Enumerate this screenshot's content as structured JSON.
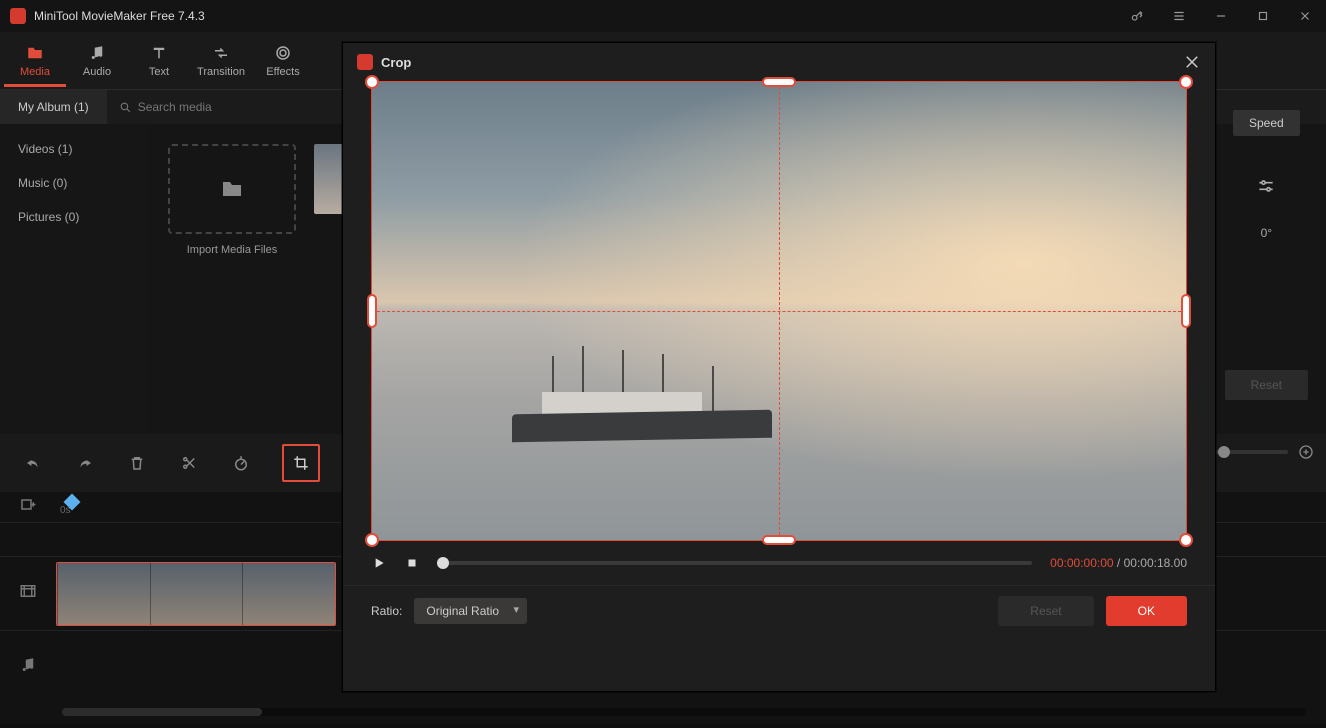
{
  "app_title": "MiniTool MovieMaker Free 7.4.3",
  "toolbar": [
    {
      "label": "Media",
      "active": true
    },
    {
      "label": "Audio",
      "active": false
    },
    {
      "label": "Text",
      "active": false
    },
    {
      "label": "Transition",
      "active": false
    },
    {
      "label": "Effects",
      "active": false
    }
  ],
  "subbar": {
    "album": "My Album (1)",
    "search_placeholder": "Search media"
  },
  "sidebar": [
    {
      "label": "Videos (1)"
    },
    {
      "label": "Music (0)"
    },
    {
      "label": "Pictures (0)"
    }
  ],
  "import_label": "Import Media Files",
  "right_panel": {
    "speed": "Speed",
    "rotation": "0°",
    "reset": "Reset"
  },
  "timeline": {
    "start_label": "0s"
  },
  "dialog": {
    "title": "Crop",
    "time_current": "00:00:00:00",
    "time_sep": " / ",
    "time_total": "00:00:18.00",
    "ratio_label": "Ratio:",
    "ratio_value": "Original Ratio",
    "reset": "Reset",
    "ok": "OK"
  }
}
